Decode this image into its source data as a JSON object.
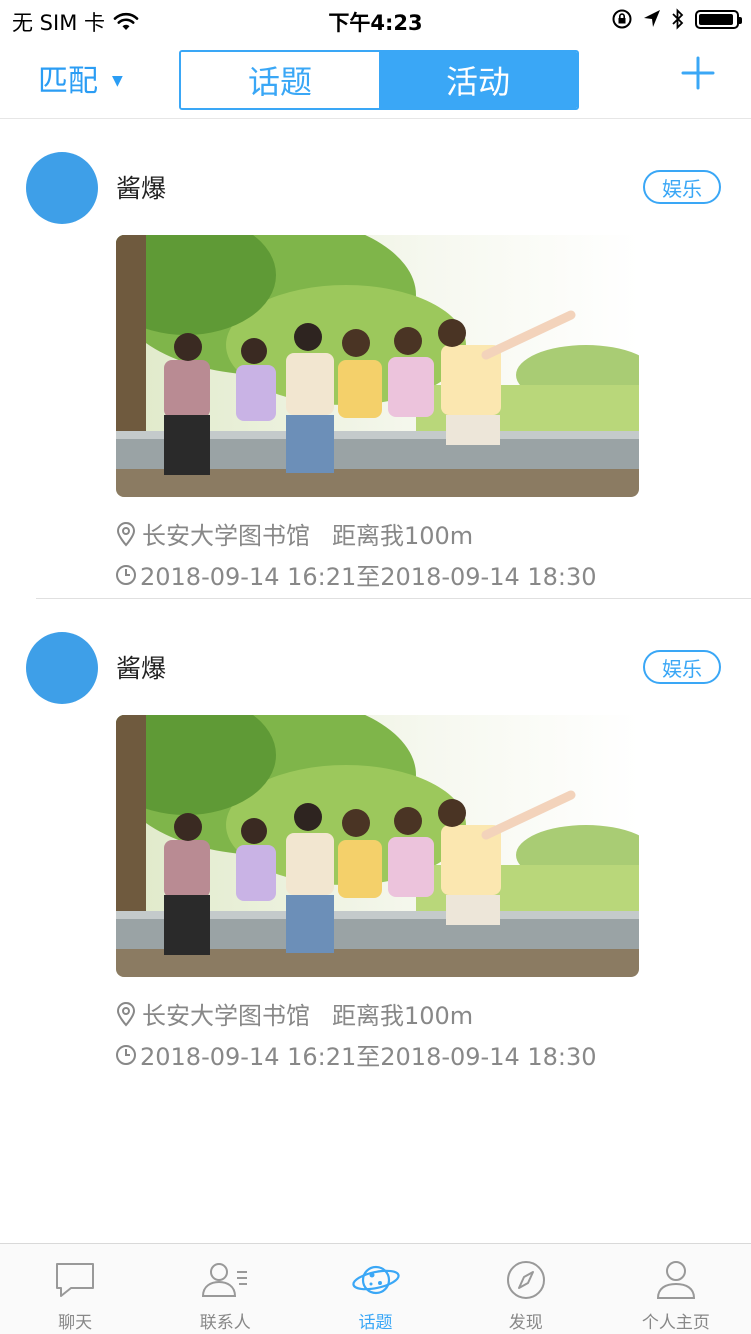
{
  "status_bar": {
    "carrier": "无 SIM 卡",
    "time": "下午4:23",
    "battery_level": 0.95
  },
  "header": {
    "match_label": "匹配",
    "segments": [
      {
        "label": "话题",
        "active": false
      },
      {
        "label": "活动",
        "active": true
      }
    ],
    "accent_color": "#3aa7f6"
  },
  "feed": [
    {
      "username": "酱爆",
      "tag": "娱乐",
      "location": "长安大学图书馆",
      "distance": "距离我100m",
      "time_range": "2018-09-14 16:21至2018-09-14 18:30"
    },
    {
      "username": "酱爆",
      "tag": "娱乐",
      "location": "长安大学图书馆",
      "distance": "距离我100m",
      "time_range": "2018-09-14 16:21至2018-09-14 18:30"
    }
  ],
  "tabbar": {
    "items": [
      {
        "label": "聊天",
        "icon": "chat-bubble-icon"
      },
      {
        "label": "联系人",
        "icon": "contacts-icon"
      },
      {
        "label": "话题",
        "icon": "planet-icon",
        "active": true
      },
      {
        "label": "发现",
        "icon": "compass-icon"
      },
      {
        "label": "个人主页",
        "icon": "person-icon"
      }
    ]
  }
}
